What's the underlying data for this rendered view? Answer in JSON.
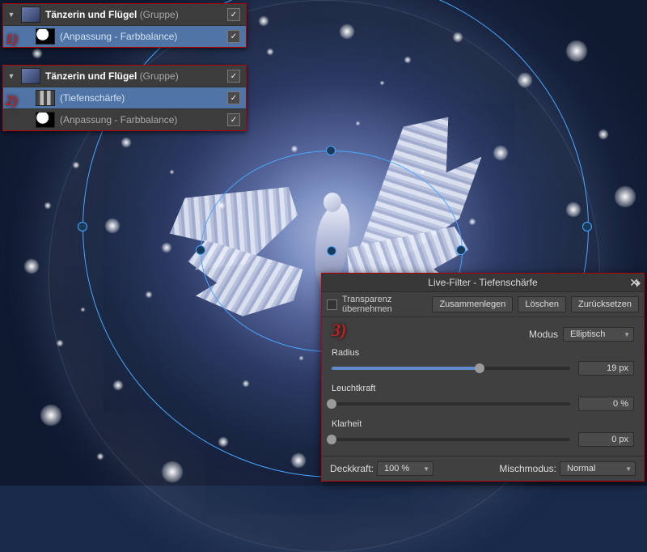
{
  "markers": {
    "m1": "1)",
    "m2": "2)",
    "m3": "3)"
  },
  "panel1": {
    "group_name": "Tänzerin und Flügel",
    "group_suffix": "(Gruppe)",
    "child1": "(Anpassung - Farbbalance)"
  },
  "panel2": {
    "group_name": "Tänzerin und Flügel",
    "group_suffix": "(Gruppe)",
    "child1": "(Tiefenschärfe)",
    "child2": "(Anpassung - Farbbalance)"
  },
  "dialog": {
    "title": "Live-Filter - Tiefenschärfe",
    "transparent": "Transparenz übernehmen",
    "merge": "Zusammenlegen",
    "delete": "Löschen",
    "reset": "Zurücksetzen",
    "modus_label": "Modus",
    "modus_value": "Elliptisch",
    "radius_label": "Radius",
    "radius_value": "19 px",
    "leucht_label": "Leuchtkraft",
    "leucht_value": "0 %",
    "klar_label": "Klarheit",
    "klar_value": "0 px",
    "opacity_label": "Deckkraft:",
    "opacity_value": "100 %",
    "blend_label": "Mischmodus:",
    "blend_value": "Normal"
  },
  "icons": {
    "close": "✕",
    "chevron": "▼",
    "check": "✓",
    "tri_open": "▼"
  }
}
